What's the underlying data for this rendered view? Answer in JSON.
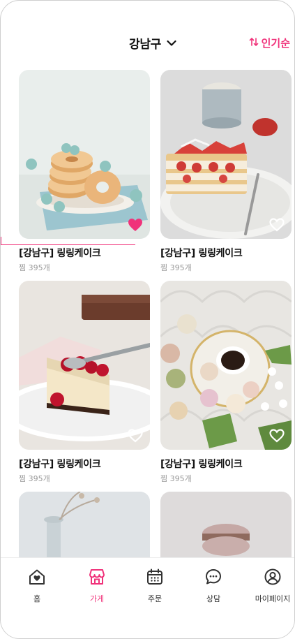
{
  "header": {
    "location": "강남구",
    "sort_label": "인기순"
  },
  "colors": {
    "accent": "#f0327a",
    "muted": "#999999"
  },
  "stores": [
    {
      "title": "[강남구] 링링케이크",
      "likes": "찜 395개",
      "liked": true,
      "image": "donut-stack"
    },
    {
      "title": "[강남구] 링링케이크",
      "likes": "찜 395개",
      "liked": false,
      "image": "strawberry-mille-feuille"
    },
    {
      "title": "[강남구] 링링케이크",
      "likes": "찜 395개",
      "liked": false,
      "image": "berry-cheesecake"
    },
    {
      "title": "[강남구] 링링케이크",
      "likes": "찜 395개",
      "liked": false,
      "image": "macarons-coffee"
    },
    {
      "title": "",
      "likes": "",
      "liked": false,
      "image": "vase-partial"
    },
    {
      "title": "",
      "likes": "",
      "liked": false,
      "image": "macaron-partial"
    }
  ],
  "tabbar": {
    "items": [
      {
        "label": "홈",
        "icon": "home-icon",
        "active": false
      },
      {
        "label": "가게",
        "icon": "store-icon",
        "active": true
      },
      {
        "label": "주문",
        "icon": "calendar-icon",
        "active": false
      },
      {
        "label": "상담",
        "icon": "chat-icon",
        "active": false
      },
      {
        "label": "마이페이지",
        "icon": "user-icon",
        "active": false
      }
    ]
  }
}
